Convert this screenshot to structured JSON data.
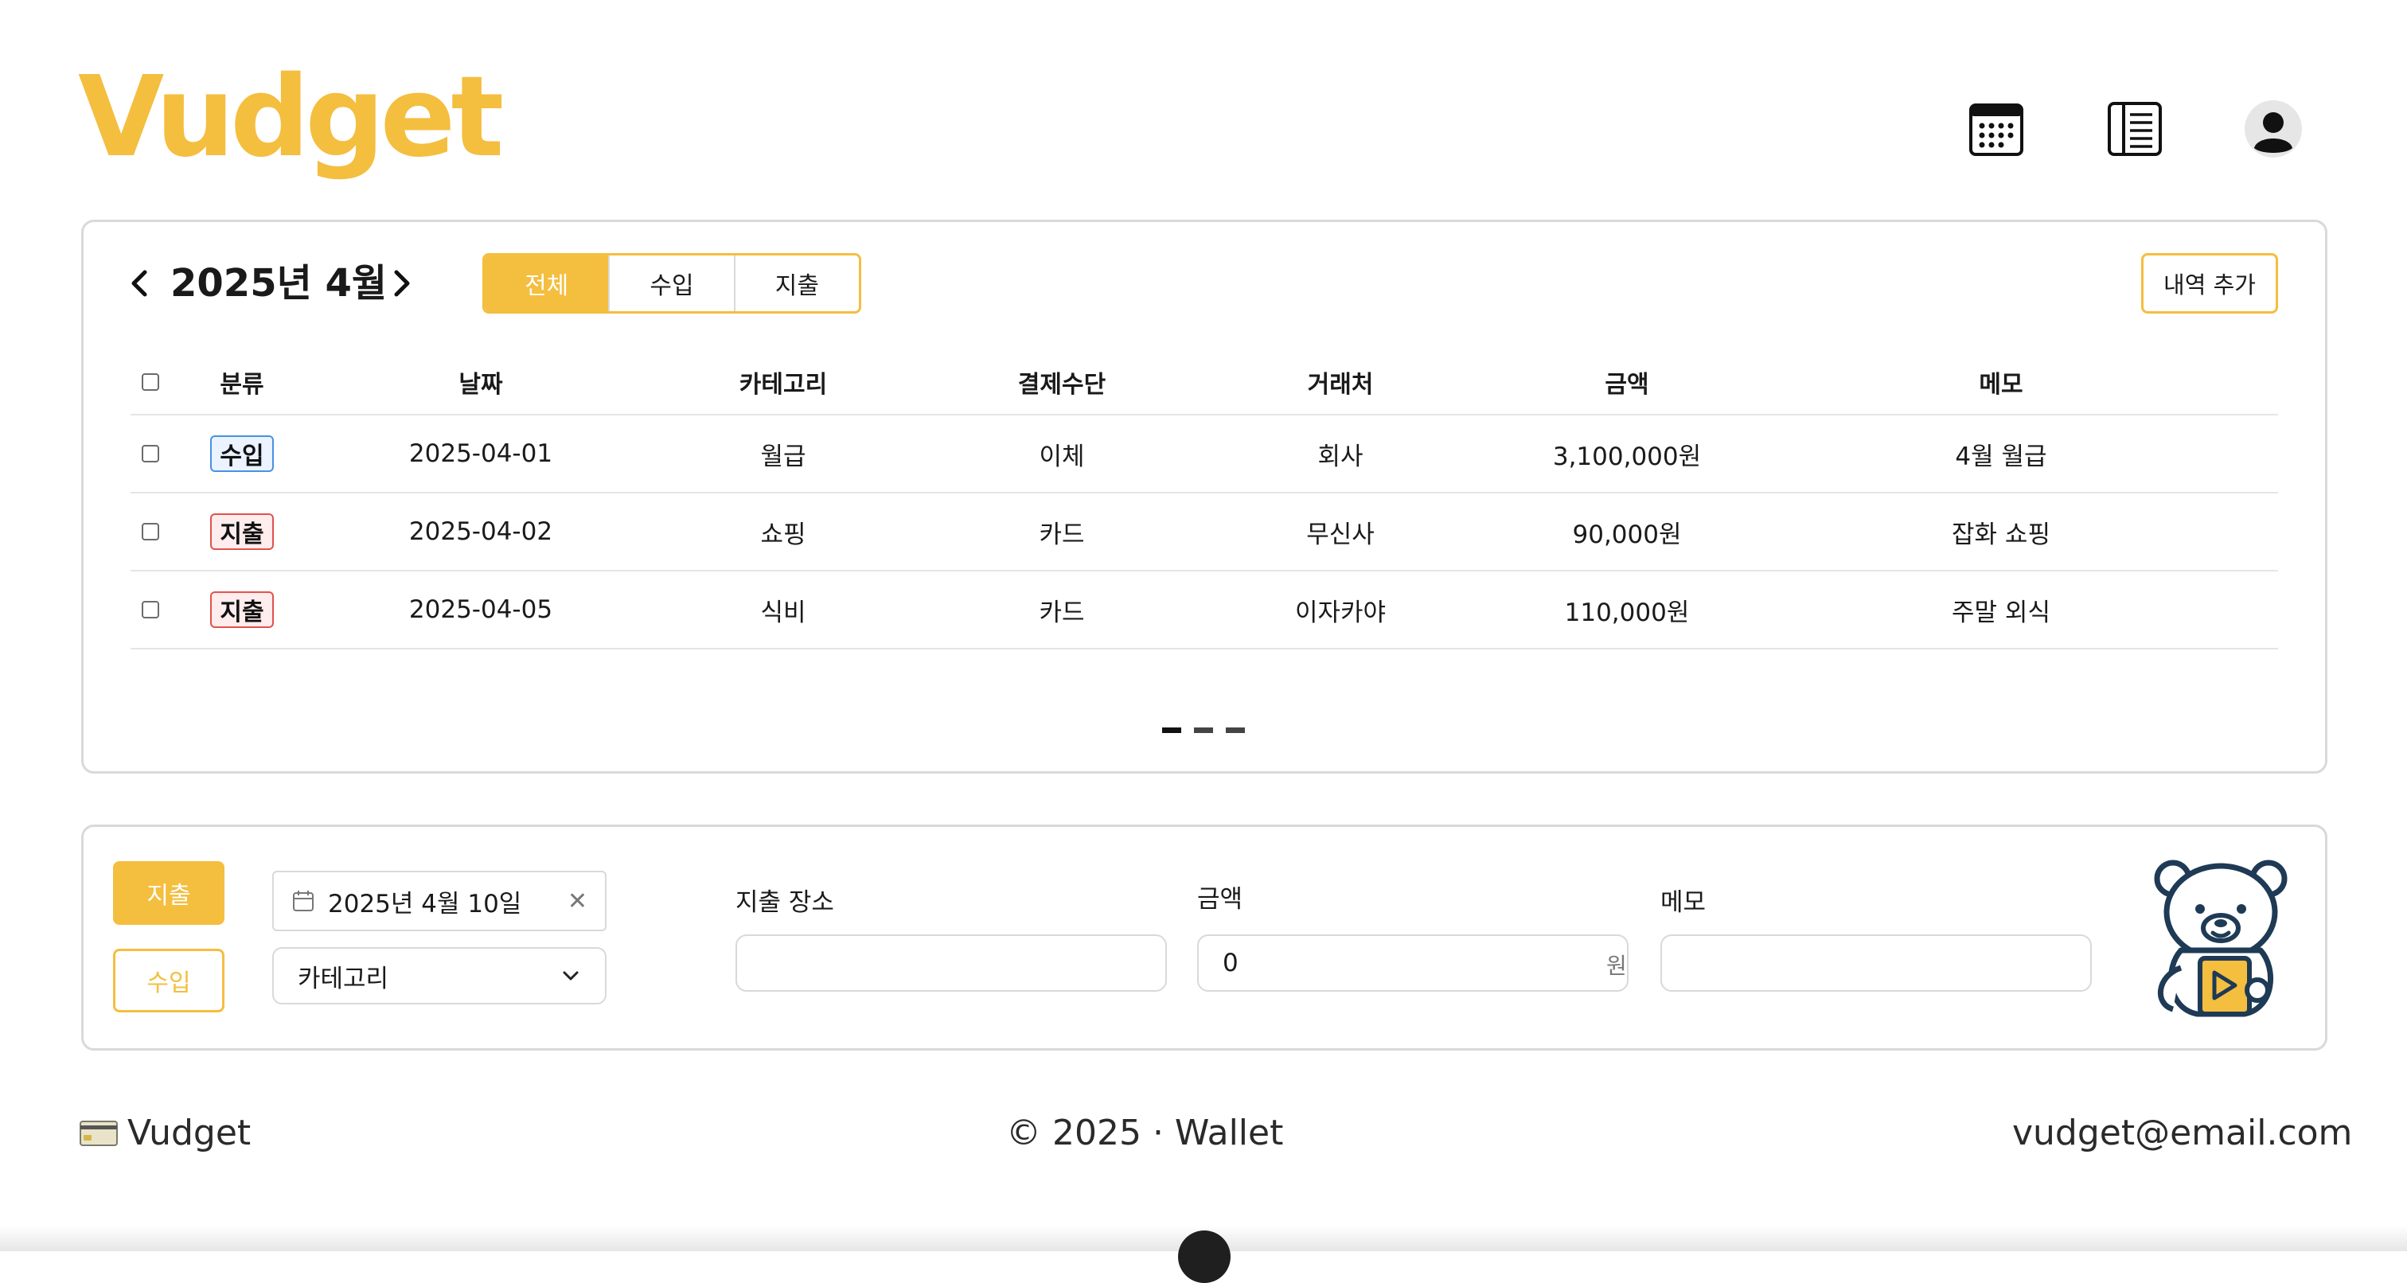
{
  "app": {
    "logo": "Vudget",
    "accent_color": "#F4BE3F"
  },
  "header": {
    "icons": [
      "calendar-icon",
      "list-icon",
      "user-avatar-icon"
    ]
  },
  "ledger": {
    "month_title": "2025년 4월",
    "prev_icon": "chevron-left-icon",
    "next_icon": "chevron-right-icon",
    "filters": [
      "전체",
      "수입",
      "지출"
    ],
    "active_filter": "전체",
    "add_button": "내역 추가",
    "columns": [
      "분류",
      "날짜",
      "카테고리",
      "결제수단",
      "거래처",
      "금액",
      "메모"
    ],
    "rows": [
      {
        "type": "수입",
        "kind": "income",
        "date": "2025-04-01",
        "category": "월급",
        "method": "이체",
        "vendor": "회사",
        "amount": "3,100,000원",
        "memo": "4월 월급"
      },
      {
        "type": "지출",
        "kind": "expense",
        "date": "2025-04-02",
        "category": "쇼핑",
        "method": "카드",
        "vendor": "무신사",
        "amount": "90,000원",
        "memo": "잡화 쇼핑"
      },
      {
        "type": "지출",
        "kind": "expense",
        "date": "2025-04-05",
        "category": "식비",
        "method": "카드",
        "vendor": "이자카야",
        "amount": "110,000원",
        "memo": "주말 외식"
      }
    ],
    "pages": 3,
    "current_page": 1,
    "income_color": "#4a90e2",
    "expense_color": "#e0524f"
  },
  "entry_form": {
    "type_buttons": [
      "지출",
      "수입"
    ],
    "active_type": "지출",
    "date_value": "2025년 4월 10일",
    "category_placeholder": "카테고리",
    "place_label": "지출 장소",
    "place_value": "",
    "amount_label": "금액",
    "amount_value": "0",
    "amount_unit": "원",
    "memo_label": "메모",
    "memo_value": "",
    "mascot": "bear-mascot-icon"
  },
  "footer": {
    "brand": "Vudget",
    "copyright": "© 2025 · Wallet",
    "email": "vudget@email.com"
  }
}
